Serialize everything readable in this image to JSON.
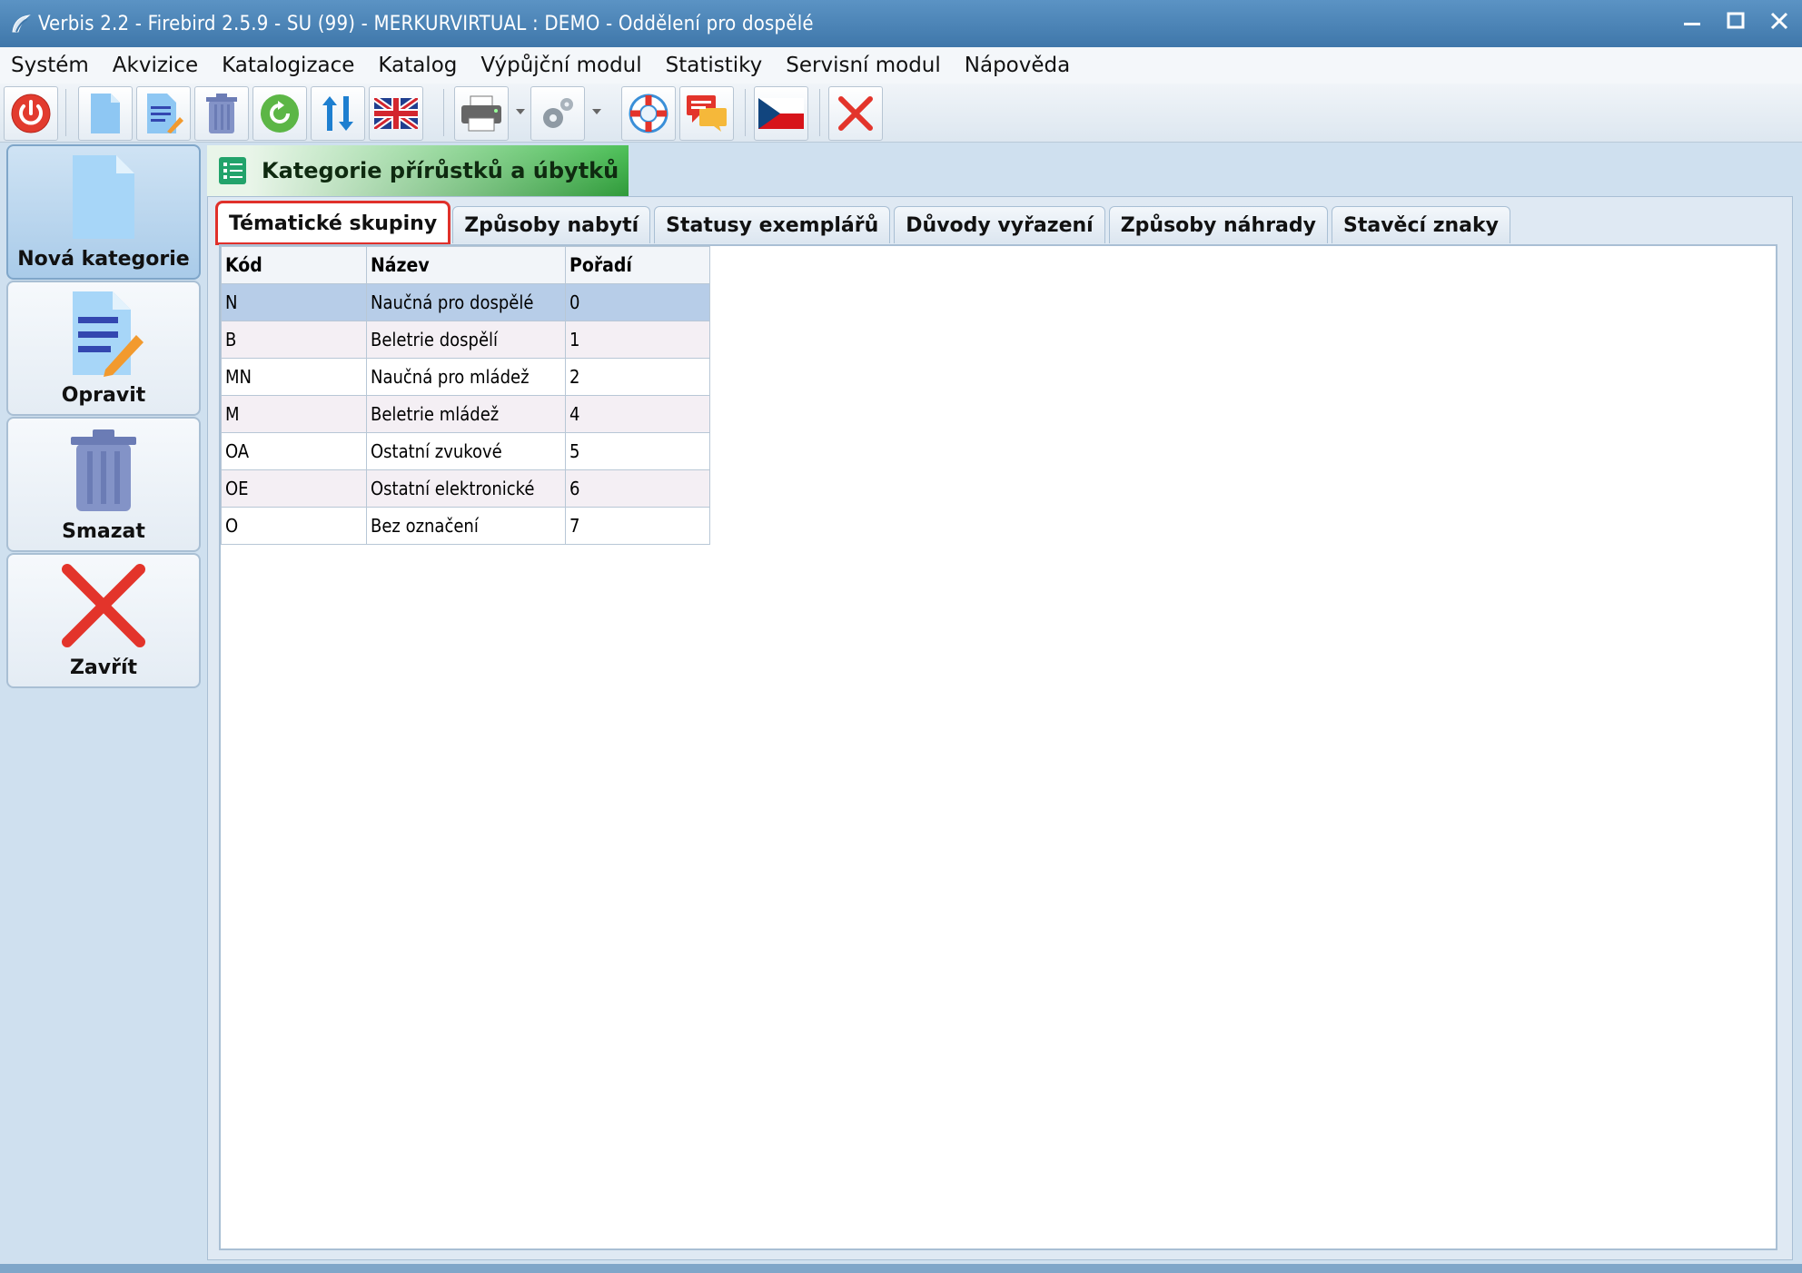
{
  "window": {
    "title": "Verbis 2.2 - Firebird 2.5.9 - SU (99) - MERKURVIRTUAL : DEMO - Oddělení pro dospělé"
  },
  "menu": [
    "Systém",
    "Akvizice",
    "Katalogizace",
    "Katalog",
    "Výpůjční modul",
    "Statistiky",
    "Servisní modul",
    "Nápověda"
  ],
  "toolbar": {
    "buttons": [
      "power-icon",
      "new-document-icon",
      "edit-document-icon",
      "trash-icon",
      "refresh-icon",
      "sort-arrows-icon",
      "uk-flag-icon",
      "printer-icon",
      "gear-icon",
      "lifebuoy-icon",
      "chat-icon",
      "czech-flag-icon",
      "close-x-icon"
    ]
  },
  "actions": [
    {
      "label": "Nová kategorie",
      "icon": "new-document-icon"
    },
    {
      "label": "Opravit",
      "icon": "edit-document-icon"
    },
    {
      "label": "Smazat",
      "icon": "trash-icon"
    },
    {
      "label": "Zavřít",
      "icon": "close-x-icon"
    }
  ],
  "form": {
    "title": "Kategorie přírůstků a úbytků"
  },
  "tabs": [
    "Tématické skupiny",
    "Způsoby nabytí",
    "Statusy exemplářů",
    "Důvody vyřazení",
    "Způsoby náhrady",
    "Stavěcí znaky"
  ],
  "selected_tab": "Tématické skupiny",
  "table": {
    "columns": [
      "Kód",
      "Název",
      "Pořadí"
    ],
    "rows": [
      [
        "N",
        "Naučná pro dospělé",
        "0"
      ],
      [
        "B",
        "Beletrie dospělí",
        "1"
      ],
      [
        "MN",
        "Naučná pro mládež",
        "2"
      ],
      [
        "M",
        "Beletrie mládež",
        "4"
      ],
      [
        "OA",
        "Ostatní zvukové",
        "5"
      ],
      [
        "OE",
        "Ostatní elektronické",
        "6"
      ],
      [
        "O",
        "Bez označení",
        "7"
      ]
    ],
    "selected_row": 0
  },
  "colors": {
    "titlebar": "#4a85ba",
    "form_tab_green": "#3aa845",
    "selection_blue": "#b7cde8",
    "highlight_red": "#e0302a"
  }
}
